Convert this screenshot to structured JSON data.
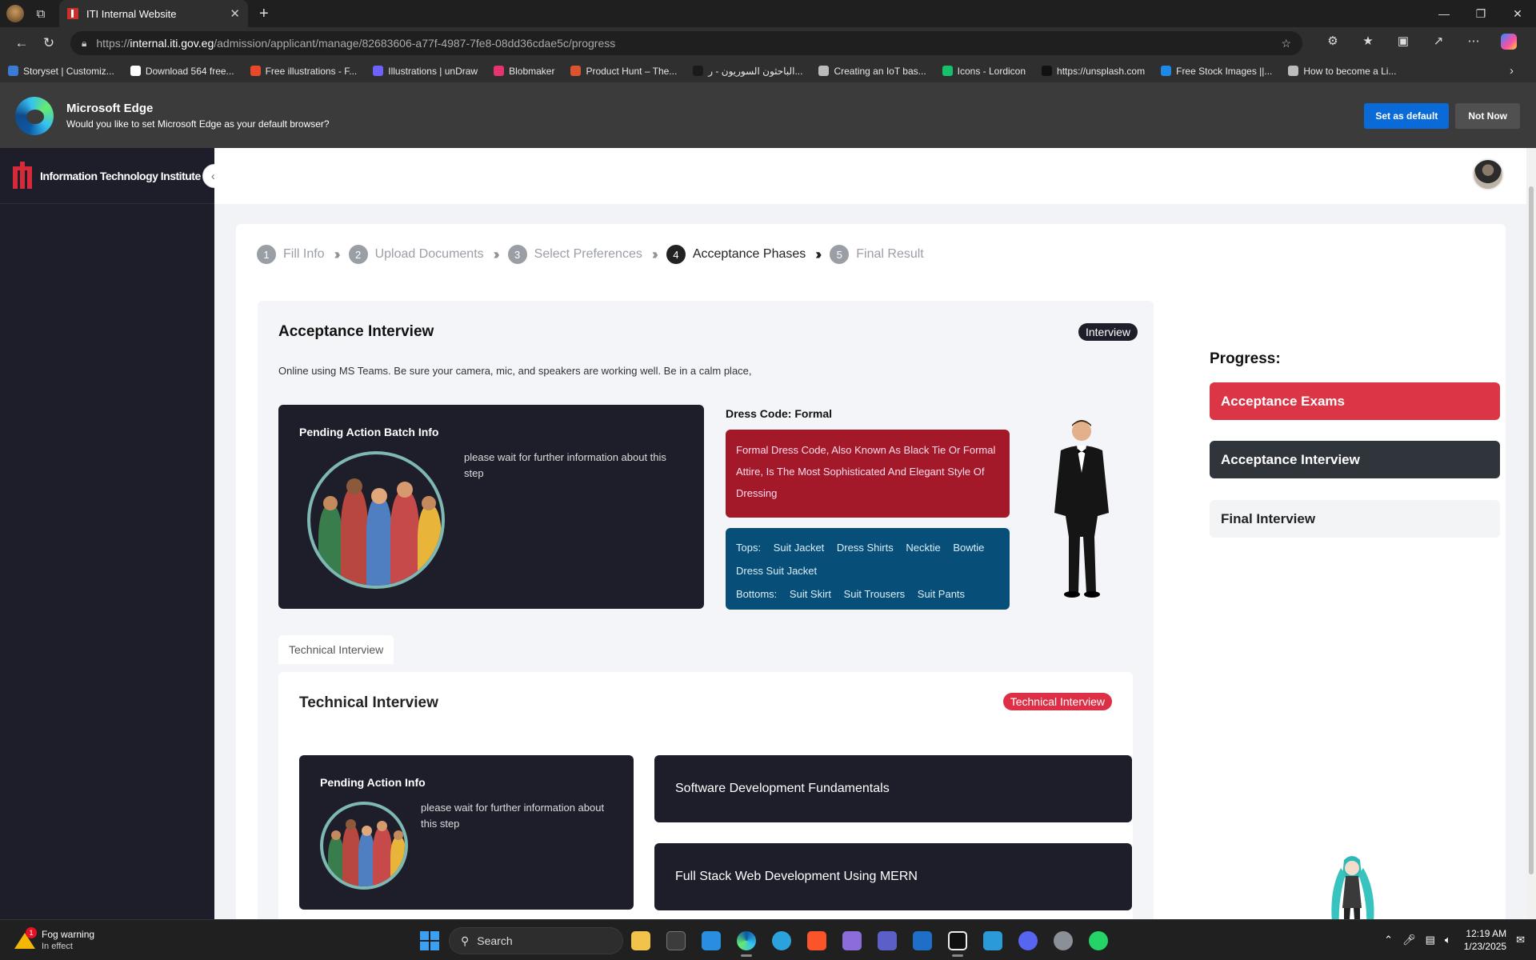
{
  "browser": {
    "tab_title": "ITI Internal Website",
    "url_prefix": "https://",
    "url_host": "internal.iti.gov.eg",
    "url_path": "/admission/applicant/manage/82683606-a77f-4987-7fe8-08dd36cdae5c/progress",
    "favorites": [
      {
        "label": "Storyset | Customiz...",
        "color": "#3a7bd5"
      },
      {
        "label": "Download 564 free...",
        "color": "#ffffff"
      },
      {
        "label": "Free illustrations - F...",
        "color": "#e8492b"
      },
      {
        "label": "Illustrations | unDraw",
        "color": "#6c63ff"
      },
      {
        "label": "Blobmaker",
        "color": "#e5346e"
      },
      {
        "label": "Product Hunt – The...",
        "color": "#da552f"
      },
      {
        "label": "الباحثون السوريون - ر...",
        "color": "#1a1a1a"
      },
      {
        "label": "Creating an IoT bas...",
        "color": "#bbbbbb"
      },
      {
        "label": "Icons - Lordicon",
        "color": "#15c26b"
      },
      {
        "label": "https://unsplash.com",
        "color": "#111111"
      },
      {
        "label": "Free Stock Images ||...",
        "color": "#1e88e5"
      },
      {
        "label": "How to become a Li...",
        "color": "#bbbbbb"
      }
    ],
    "edge_prompt": {
      "title": "Microsoft Edge",
      "message": "Would you like to set Microsoft Edge as your default browser?",
      "primary": "Set as default",
      "secondary": "Not Now"
    }
  },
  "sidebar": {
    "brand": "Information Technology Institute",
    "brand_color": "#d6293a"
  },
  "steps": [
    {
      "num": "1",
      "label": "Fill Info",
      "state": "done"
    },
    {
      "num": "2",
      "label": "Upload Documents",
      "state": "done"
    },
    {
      "num": "3",
      "label": "Select Preferences",
      "state": "done"
    },
    {
      "num": "4",
      "label": "Acceptance Phases",
      "state": "active"
    },
    {
      "num": "5",
      "label": "Final Result",
      "state": "upcoming"
    }
  ],
  "interview": {
    "title": "Acceptance Interview",
    "badge": "Interview",
    "description": "Online using MS Teams. Be sure your camera, mic, and speakers are working well. Be in a calm place,",
    "batch": {
      "title": "Pending Action Batch Info",
      "message": "please wait for further information about this step"
    },
    "dress": {
      "title": "Dress Code: Formal",
      "summary": "Formal Dress Code, Also Known As Black Tie Or Formal Attire, Is The Most Sophisticated And Elegant Style Of Dressing",
      "tops_label": "Tops:",
      "tops": [
        "Suit Jacket",
        "Dress Shirts",
        "Necktie",
        "Bowtie",
        "Dress Suit Jacket"
      ],
      "bottoms_label": "Bottoms:",
      "bottoms": [
        "Suit Skirt",
        "Suit Trousers",
        "Suit Pants"
      ]
    }
  },
  "technical": {
    "tab_label": "Technical Interview",
    "title": "Technical Interview",
    "badge": "Technical Interview",
    "pending": {
      "title": "Pending Action Info",
      "message": "please wait for further information about this step"
    },
    "tracks": [
      "Software Development Fundamentals",
      "Full Stack Web Development Using MERN"
    ]
  },
  "progress": {
    "title": "Progress:",
    "items": [
      {
        "label": "Acceptance Exams",
        "state": "failed"
      },
      {
        "label": "Acceptance Interview",
        "state": "current"
      },
      {
        "label": "Final Interview",
        "state": "pending"
      }
    ]
  },
  "taskbar": {
    "weather_title": "Fog warning",
    "weather_sub": "In effect",
    "weather_badge": "1",
    "search": "Search",
    "time": "12:19 AM",
    "date": "1/23/2025"
  }
}
